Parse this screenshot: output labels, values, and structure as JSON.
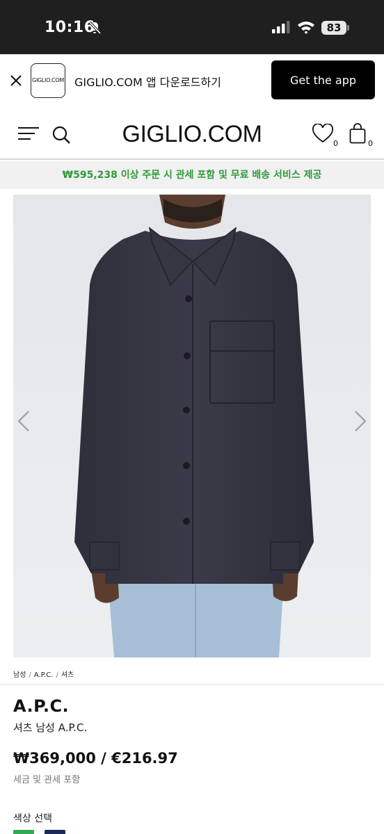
{
  "status_bar": {
    "time": "10:16",
    "battery": "83"
  },
  "app_banner": {
    "logo_text": "GIGLIO.COM",
    "text": "GIGLIO.COM 앱 다운로드하기",
    "cta_label": "Get the app"
  },
  "header": {
    "logo": "GIGLIO.COM",
    "wishlist_count": "0",
    "bag_count": "0"
  },
  "promo": {
    "text": "₩595,238 이상 주문 시 관세 포함 및 무료 배송 서비스 제공",
    "color": "#2f9a3a"
  },
  "breadcrumb": [
    "남성",
    "A.P.C.",
    "셔츠"
  ],
  "product": {
    "brand": "A.P.C.",
    "name": "셔츠 남성 A.P.C.",
    "price": "₩369,000 / €216.97",
    "tax_note": "세금 및 관세 포함",
    "color_label": "색상 선택",
    "swatches": [
      "#35a855",
      "#1c2a57"
    ]
  },
  "icons": [
    "bell-off-icon",
    "signal-icon",
    "wifi-icon",
    "battery-icon",
    "close-icon",
    "menu-icon",
    "search-icon",
    "heart-icon",
    "bag-icon",
    "chevron-left-icon",
    "chevron-right-icon"
  ]
}
